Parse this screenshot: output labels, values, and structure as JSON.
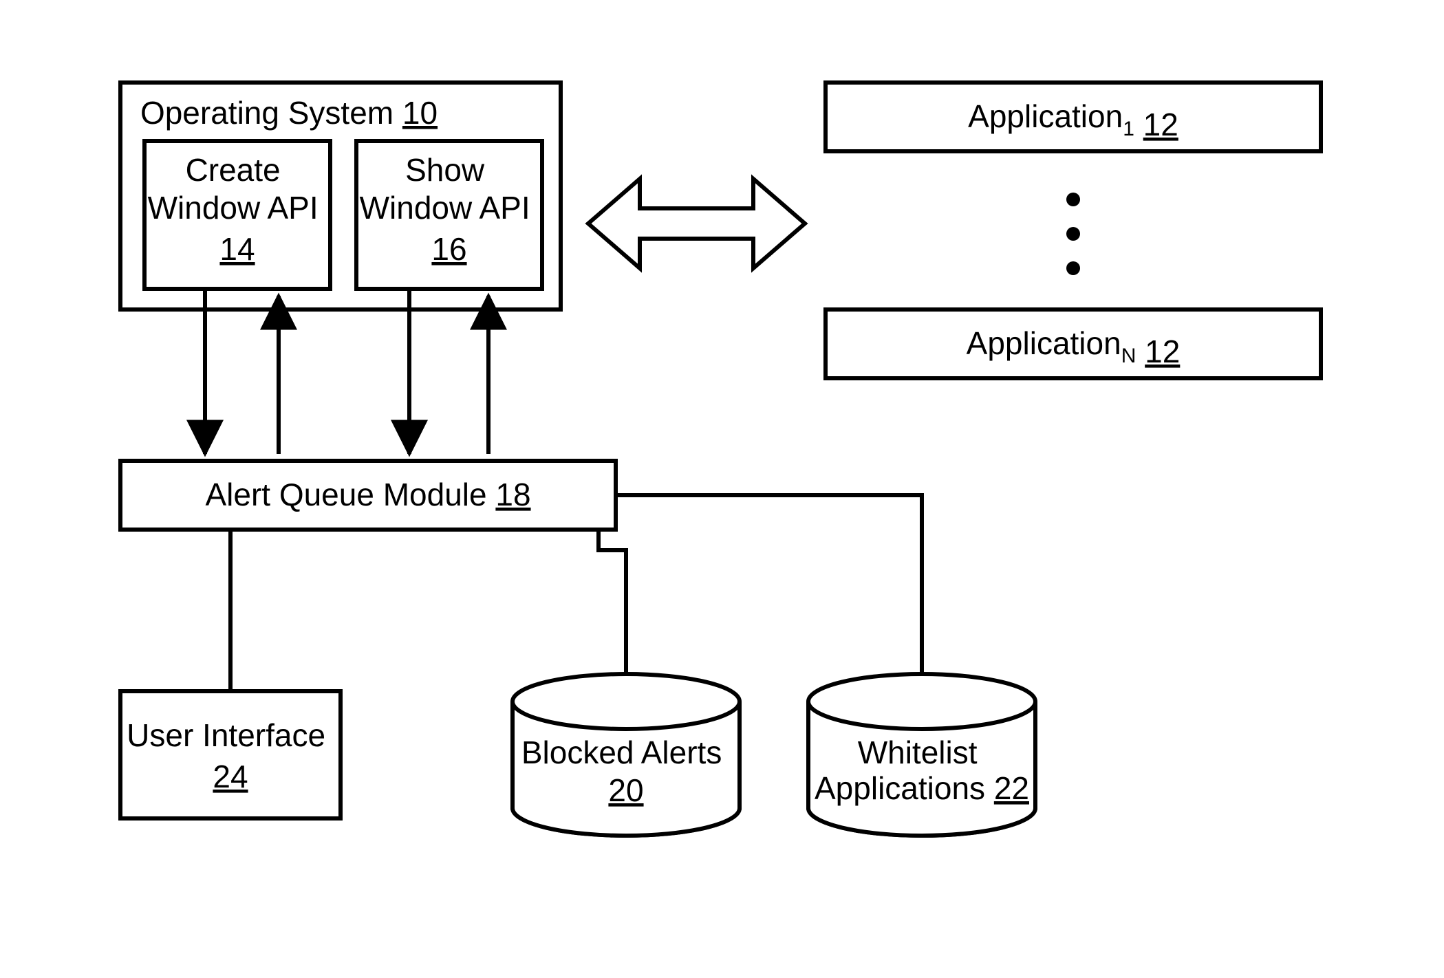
{
  "os": {
    "title": "Operating System",
    "ref": "10"
  },
  "create_api": {
    "line1": "Create",
    "line2": "Window API",
    "ref": "14"
  },
  "show_api": {
    "line1": "Show",
    "line2": "Window API",
    "ref": "16"
  },
  "app1": {
    "label": "Application",
    "sub": "1",
    "ref": "12"
  },
  "appN": {
    "label": "Application",
    "sub": "N",
    "ref": "12"
  },
  "alert_queue": {
    "label": "Alert Queue Module",
    "ref": "18"
  },
  "ui_box": {
    "label": "User Interface",
    "ref": "24"
  },
  "blocked": {
    "label": "Blocked Alerts",
    "ref": "20"
  },
  "whitelist": {
    "line1": "Whitelist",
    "line2": "Applications",
    "ref": "22"
  }
}
